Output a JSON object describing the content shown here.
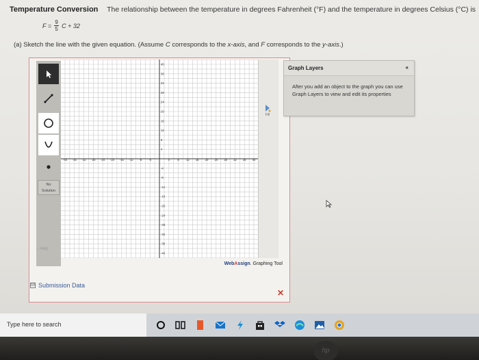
{
  "header": {
    "title": "Temperature Conversion",
    "description": "The relationship between the temperature in degrees Fahrenheit (°F) and the temperature in degrees Celsius (°C) is"
  },
  "equation": {
    "lhs": "F =",
    "num": "9",
    "den": "5",
    "rhs": "C + 32"
  },
  "part_a": {
    "label": "(a)",
    "text": "Sketch the line with the given equation. (Assume",
    "var_c": "C",
    "text2": "corresponds to the",
    "x_axis": "x-axis",
    "text3": ", and",
    "var_f": "F",
    "text4": "corresponds to the",
    "y_axis": "y-axis",
    "text5": ".)"
  },
  "toolbar": {
    "no_solution_line1": "No",
    "no_solution_line2": "Solution",
    "help": "Help",
    "fill": "Fill"
  },
  "graph": {
    "x_ticks": [
      "-40",
      "-36",
      "-32",
      "-28",
      "-24",
      "-20",
      "-16",
      "-12",
      "-8",
      "-4",
      "4",
      "8",
      "12",
      "16",
      "20",
      "24",
      "28",
      "32",
      "36",
      "40"
    ],
    "y_ticks": [
      "40",
      "36",
      "32",
      "28",
      "24",
      "20",
      "16",
      "12",
      "8",
      "4",
      "-4",
      "-8",
      "-12",
      "-16",
      "-20",
      "-24",
      "-28",
      "-32",
      "-36",
      "-40"
    ]
  },
  "brand": {
    "w": "Web",
    "a": "A",
    "rest": "ssign",
    "suffix": ". Graphing Tool"
  },
  "layers": {
    "title": "Graph Layers",
    "collapse": "«",
    "body": "After you add an object to the graph you can use Graph Layers to view and edit its properties"
  },
  "close_symbol": "✕",
  "submission": {
    "toggle": "⊟",
    "label": "Submission Data"
  },
  "taskbar": {
    "search_placeholder": "Type here to search"
  },
  "colors": {
    "accent_red": "#d03a2a",
    "brand_blue": "#1f3c7a"
  }
}
